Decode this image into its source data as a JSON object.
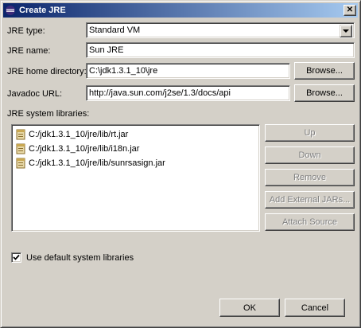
{
  "window": {
    "title": "Create JRE"
  },
  "form": {
    "jre_type_label": "JRE type:",
    "jre_type_value": "Standard VM",
    "jre_name_label": "JRE name:",
    "jre_name_value": "Sun JRE",
    "home_label": "JRE home directory:",
    "home_value": "C:\\jdk1.3.1_10\\jre",
    "javadoc_label": "Javadoc URL:",
    "javadoc_value": "http://java.sun.com/j2se/1.3/docs/api",
    "browse_label": "Browse...",
    "libraries_label": "JRE system libraries:"
  },
  "libraries": [
    {
      "path": "C:/jdk1.3.1_10/jre/lib/rt.jar",
      "icon": "jar-icon"
    },
    {
      "path": "C:/jdk1.3.1_10/jre/lib/i18n.jar",
      "icon": "jar-icon"
    },
    {
      "path": "C:/jdk1.3.1_10/jre/lib/sunrsasign.jar",
      "icon": "jar-icon"
    }
  ],
  "library_buttons": {
    "up": "Up",
    "down": "Down",
    "remove": "Remove",
    "add_external": "Add External JARs...",
    "attach_source": "Attach Source"
  },
  "default_libs": {
    "label": "Use default system libraries",
    "checked": true
  },
  "footer": {
    "ok": "OK",
    "cancel": "Cancel"
  }
}
